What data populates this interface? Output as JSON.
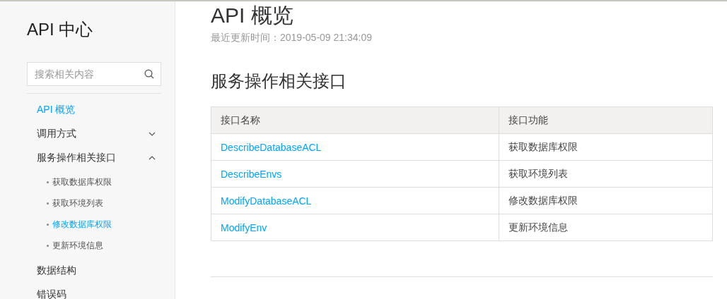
{
  "sidebar": {
    "title": "API 中心",
    "search": {
      "placeholder": "搜索相关内容"
    },
    "items": [
      {
        "label": "API 概览",
        "selected": true
      },
      {
        "label": "调用方式",
        "selected": false,
        "expanded": false
      },
      {
        "label": "服务操作相关接口",
        "selected": false,
        "expanded": true,
        "children": [
          {
            "label": "获取数据库权限",
            "selected": false
          },
          {
            "label": "获取环境列表",
            "selected": false
          },
          {
            "label": "修改数据库权限",
            "selected": true
          },
          {
            "label": "更新环境信息",
            "selected": false
          }
        ]
      },
      {
        "label": "数据结构",
        "selected": false
      },
      {
        "label": "错误码",
        "selected": false
      }
    ]
  },
  "main": {
    "title": "API 概览",
    "updated": "最近更新时间：2019-05-09 21:34:09",
    "section": "服务操作相关接口",
    "table": {
      "columns": [
        "接口名称",
        "接口功能"
      ],
      "rows": [
        [
          "DescribeDatabaseACL",
          "获取数据库权限"
        ],
        [
          "DescribeEnvs",
          "获取环境列表"
        ],
        [
          "ModifyDatabaseACL",
          "修改数据库权限"
        ],
        [
          "ModifyEnv",
          "更新环境信息"
        ]
      ]
    }
  }
}
